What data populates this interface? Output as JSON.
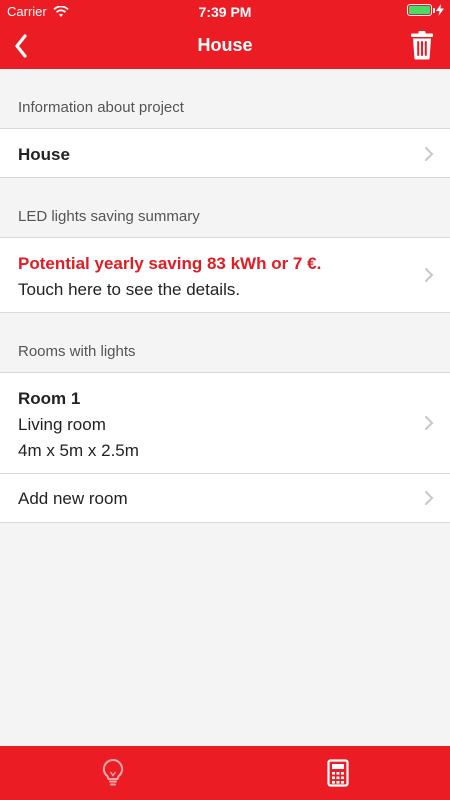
{
  "status": {
    "carrier": "Carrier",
    "time": "7:39 PM"
  },
  "nav": {
    "title": "House"
  },
  "sections": {
    "project_header": "Information about project",
    "project_name": "House",
    "saving_header": "LED lights saving summary",
    "saving_line1": "Potential yearly saving 83 kWh or 7 €.",
    "saving_line2": "Touch here to see the details.",
    "rooms_header": "Rooms with lights",
    "room": {
      "name": "Room 1",
      "type": "Living room",
      "dims": "4m x 5m x 2.5m"
    },
    "add_room": "Add new room"
  },
  "colors": {
    "accent": "#ec1c24",
    "saving_text": "#e31b23",
    "background": "#f4f4f4"
  },
  "icons": [
    "back-icon",
    "trash-icon",
    "chevron-right-icon",
    "lightbulb-icon",
    "calculator-icon",
    "wifi-icon",
    "battery-icon"
  ]
}
